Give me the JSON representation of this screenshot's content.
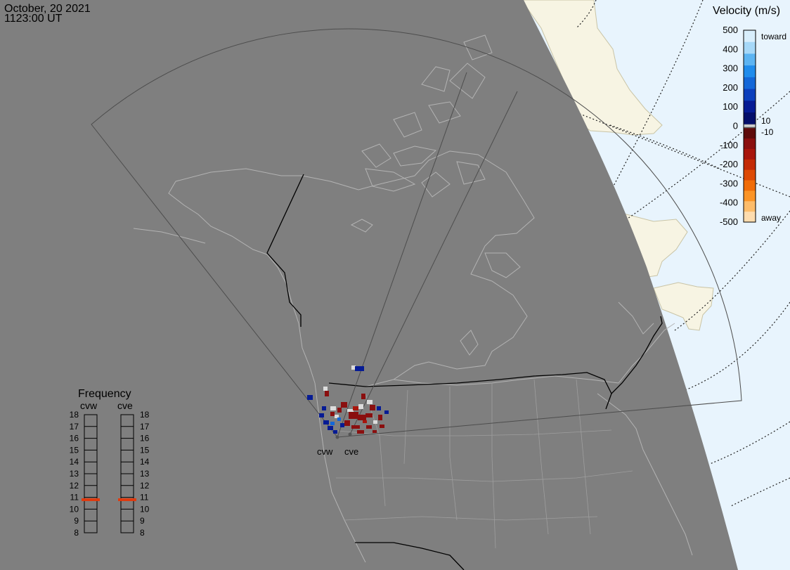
{
  "header": {
    "date": "October, 20 2021",
    "time": "1123:00 UT"
  },
  "velocity_scale": {
    "title": "Velocity (m/s)",
    "toward_label": "toward",
    "away_label": "away",
    "tick_labels": [
      "500",
      "400",
      "300",
      "200",
      "100",
      "0",
      "-100",
      "-200",
      "-300",
      "-400",
      "-500"
    ],
    "inner_labels": [
      "10",
      "-10"
    ],
    "colors_toward": [
      "#d8eefc",
      "#a6d8f8",
      "#5cb4f2",
      "#1f8cec",
      "#1367d8",
      "#0c3fbc",
      "#061b94",
      "#040e6a"
    ],
    "colors_away": [
      "#5e0b0b",
      "#8a0f0f",
      "#a8150c",
      "#c32a06",
      "#dd4a05",
      "#f06c08",
      "#fb9426",
      "#fdbc6a",
      "#fedcae"
    ],
    "gap_colors": [
      "#b5b5b5",
      "#e6e6e6",
      "#6b6b6b"
    ]
  },
  "frequency_panel": {
    "title": "Frequency",
    "radars": [
      {
        "name": "cvw",
        "freq_mhz": 10.8
      },
      {
        "name": "cve",
        "freq_mhz": 10.8
      }
    ],
    "tick_labels": [
      "18",
      "17",
      "16",
      "15",
      "14",
      "13",
      "12",
      "11",
      "10",
      "9",
      "8"
    ],
    "indicator_color": "#e03a0e"
  },
  "radar_labels": [
    "cvw",
    "cve"
  ],
  "colors": {
    "night": "#7f7f7f",
    "day_ocean": "#e8f4fd",
    "day_land": "#f7f4e3",
    "land_outline": "#b3b3b3",
    "border": "#000000",
    "fov": "#4d4d4d"
  }
}
